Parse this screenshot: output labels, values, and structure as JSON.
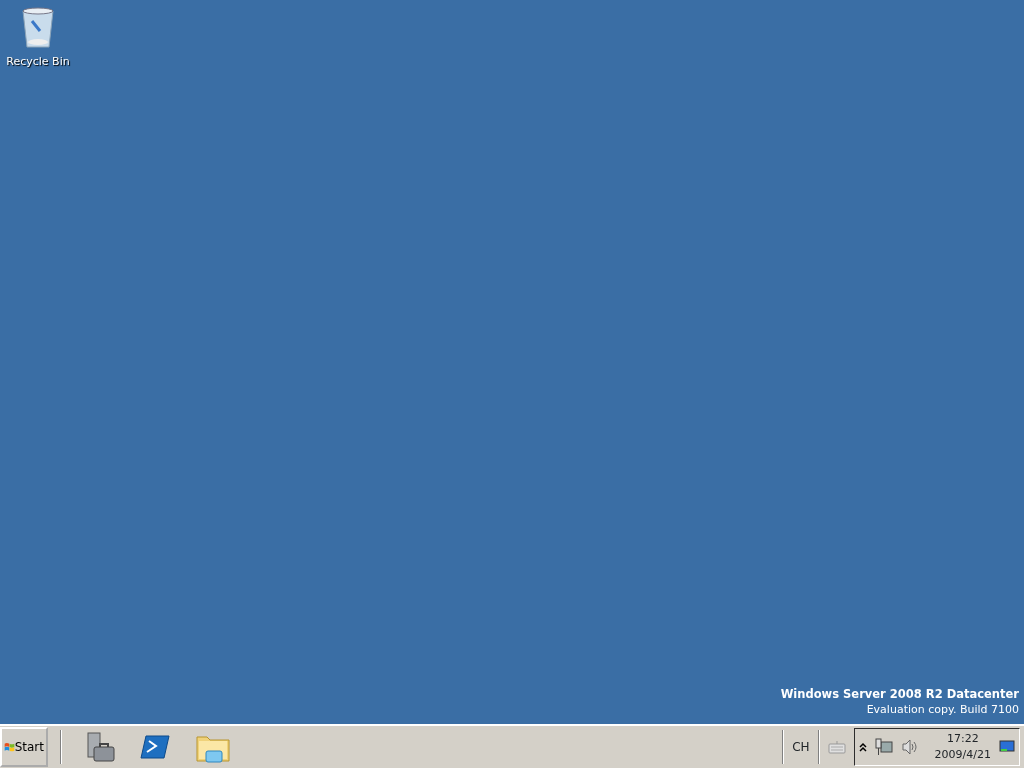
{
  "desktop_icons": [
    {
      "label": "Recycle Bin"
    }
  ],
  "edition": {
    "title": "Windows Server 2008 R2 Datacenter",
    "subtitle": "Evaluation copy. Build 7100"
  },
  "taskbar": {
    "start_label": "Start",
    "language": "CH",
    "clock": {
      "time": "17:22",
      "date": "2009/4/21"
    }
  }
}
